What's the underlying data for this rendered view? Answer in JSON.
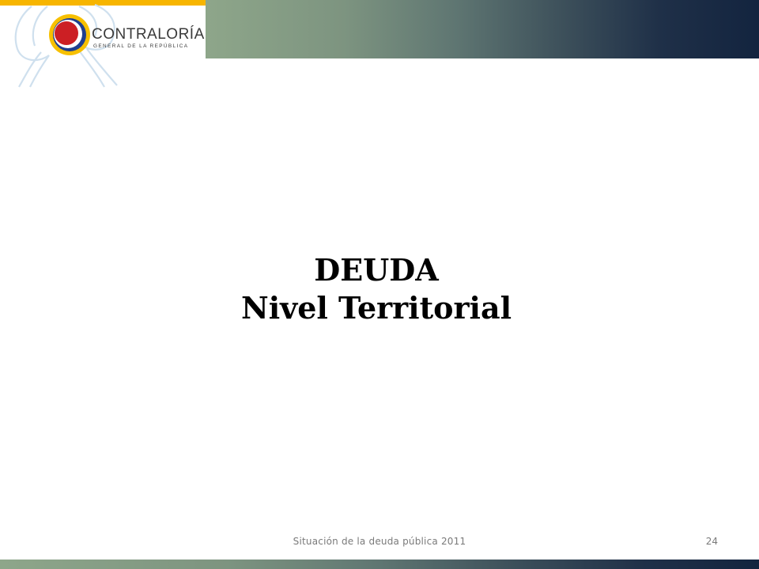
{
  "logo": {
    "name_label": "CONTRALORÍA",
    "subtitle_label": "GENERAL DE LA REPÚBLICA"
  },
  "title": {
    "line1": "DEUDA",
    "line2": "Nivel Territorial"
  },
  "footer": {
    "text": "Situación de la deuda pública 2011",
    "page_number": "24"
  },
  "colors": {
    "accent_yellow": "#f7b500",
    "seal_red": "#cc1f24",
    "seal_blue": "#1f3f8f",
    "band_dark": "#13243f",
    "band_light": "#8ea68a"
  }
}
